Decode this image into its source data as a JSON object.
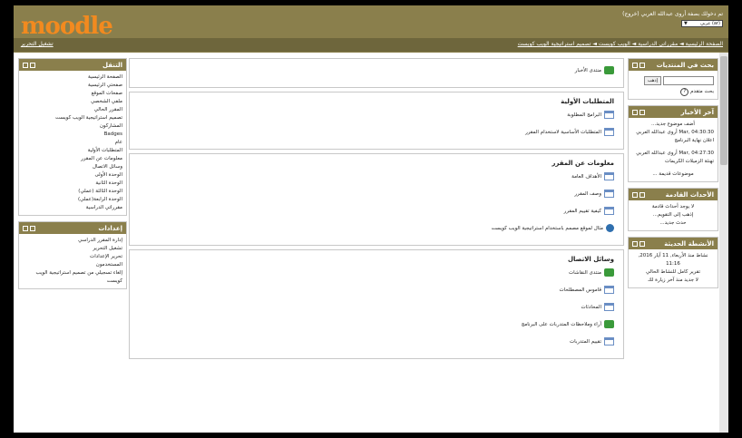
{
  "header": {
    "login_info": "تم دخولك بصفة أروى عبدالله العربي (خروج)",
    "language": "عربي (ar)",
    "logo_text": "moodle",
    "breadcrumb": "الصفحة الرئيسية ◄ مقرراتي الدراسية ◄ الويب كويست ◄ تصميم استراتيجية الويب كويست",
    "edit_button": "تشغيل التحرير"
  },
  "colors": {
    "header": "#8a7f4c",
    "accent": "#f28a1f"
  },
  "navigation": {
    "title": "التنقل",
    "items": [
      "الصفحة الرئيسية",
      "صفحتي الرئيسية",
      "صفحات الموقع",
      "ملفي الشخصي",
      "المقرر الحالي",
      "تصميم استراتيجية الويب كويست",
      "المشاركون",
      "Badges",
      "عام",
      "المتطلبات الأولية",
      "معلومات عن المقرر",
      "وسائل الاتصال",
      "الوحدة الأولى",
      "الوحدة الثانية",
      "الوحدة الثالثة (عملي)",
      "الوحدة الرابعة(عملي)",
      "مقرراتي الدراسية"
    ]
  },
  "settings": {
    "title": "إعدادات",
    "items": [
      "إدارة المقرر الدراسي",
      "تشغيل التحرير",
      "تحرير الإعدادات",
      "المستخدمون",
      "إلغاء تسجيلي من تصميم استراتيجية الويب كويست"
    ]
  },
  "center": {
    "sections": [
      {
        "title": "",
        "activities": [
          {
            "icon": "forum",
            "label": "منتدى الأخبار"
          }
        ]
      },
      {
        "title": "المتطلبات الأولية",
        "activities": [
          {
            "icon": "page",
            "label": "البرامج المطلوبة"
          },
          {
            "icon": "page",
            "label": "المتطلبات الأساسية لاستخدام المقرر"
          }
        ]
      },
      {
        "title": "معلومات عن المقرر",
        "activities": [
          {
            "icon": "page",
            "label": "الأهداف العامة"
          },
          {
            "icon": "page",
            "label": "وصف المقرر"
          },
          {
            "icon": "page",
            "label": "كيفية تقييم المقرر"
          },
          {
            "icon": "url",
            "label": "مثال لموقع مصمم باستخدام استراتيجية الويب كويست"
          }
        ]
      },
      {
        "title": "وسائل الاتصال",
        "activities": [
          {
            "icon": "forum",
            "label": "منتدى النقاشات"
          },
          {
            "icon": "page",
            "label": "قاموس المصطلحات"
          },
          {
            "icon": "page",
            "label": "المحادثات"
          },
          {
            "icon": "forum",
            "label": "آراء وملاحظات المتدربات على البرنامج"
          },
          {
            "icon": "page",
            "label": "تقييم المتدربات"
          }
        ]
      }
    ]
  },
  "search_block": {
    "title": "بحث في المنتديات",
    "button": "إذهب",
    "advanced": "بحث متقدم"
  },
  "news_block": {
    "title": "آخر الأخبار",
    "add_new": "أضف موضوع جديد...",
    "items": [
      {
        "date": "Mar, 04:30:30",
        "author": "أروى عبدالله العربي",
        "text": "اعلان نهاية البرنامج"
      },
      {
        "date": "Mar, 04:27:30",
        "author": "أروى عبدالله العربي",
        "text": "تهنئة الزميلات الكريمات"
      }
    ],
    "older": "موضوعات قديمة ..."
  },
  "events_block": {
    "title": "الأحداث القادمة",
    "none": "لا يوجد أحداث قادمة",
    "calendar": "إذهب إلى التقويم...",
    "new_event": "حدث جديد..."
  },
  "activity_block": {
    "title": "الأنشطة الحديثة",
    "since": "نشاط منذ الأربعاء, 11 آيار 2016, 11:16",
    "report": "تقرير كامل للنشاط الحالي",
    "nothing": "لا جديد منذ آخر زيارة لك"
  }
}
